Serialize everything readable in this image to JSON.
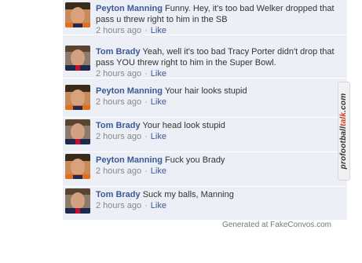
{
  "comments": [
    {
      "author": "Peyton Manning",
      "text": "Funny. Hey, it's too bad Welker dropped that pass u threw right to him in the SB",
      "time": "2 hours ago",
      "action": "Like",
      "avatar": "peyton-avatar"
    },
    {
      "author": "Tom Brady",
      "text": "Yeah, well it's too bad Tracy Porter didn't drop that pass YOU threw right to him in the Super Bowl.",
      "time": "2 hours ago",
      "action": "Like",
      "avatar": "brady-avatar"
    },
    {
      "author": "Peyton Manning",
      "text": "Your hair looks stupid",
      "time": "2 hours ago",
      "action": "Like",
      "avatar": "peyton-avatar"
    },
    {
      "author": "Tom Brady",
      "text": "Your head look stupid",
      "time": "2 hours ago",
      "action": "Like",
      "avatar": "brady-avatar"
    },
    {
      "author": "Peyton Manning",
      "text": "Fuck you Brady",
      "time": "2 hours ago",
      "action": "Like",
      "avatar": "peyton-avatar"
    },
    {
      "author": "Tom Brady",
      "text": "Suck my balls, Manning",
      "time": "2 hours ago",
      "action": "Like",
      "avatar": "brady-avatar"
    }
  ],
  "separator": "·",
  "footer": "Generated at FakeConvos.com",
  "watermark": {
    "part1": "profootball",
    "part2": "talk",
    "part3": ".com"
  },
  "colors": {
    "name": "#3b5998",
    "meta": "#888888",
    "feed_bg": "#eceff5",
    "text": "#333333"
  }
}
